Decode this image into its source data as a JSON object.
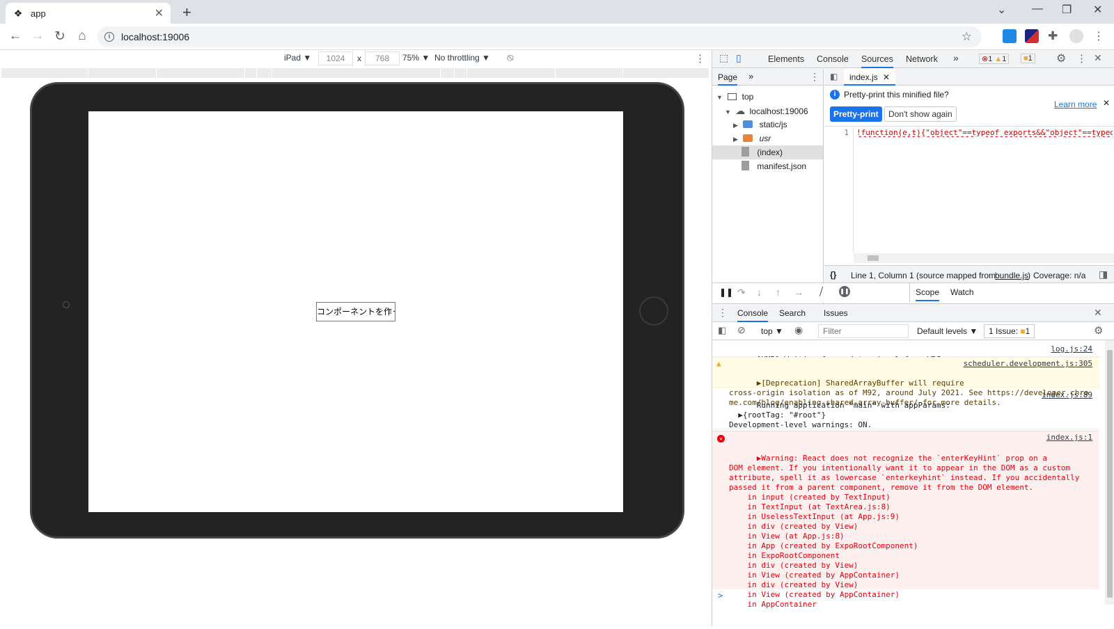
{
  "browser": {
    "tab_title": "app",
    "url": "localhost:19006"
  },
  "device_toolbar": {
    "device": "iPad ▼",
    "width": "1024",
    "x": "x",
    "height": "768",
    "zoom": "75% ▼",
    "throttling": "No throttling ▼"
  },
  "app": {
    "input_value": "コンポーネントを作って"
  },
  "devtools": {
    "tabs": [
      "Elements",
      "Console",
      "Sources",
      "Network"
    ],
    "more": "»",
    "badges": {
      "errors": "1",
      "warnings": "1",
      "issues": "1"
    },
    "navigator": {
      "header": "Page",
      "tree": [
        {
          "label": "top",
          "level": 0,
          "kind": "frame"
        },
        {
          "label": "localhost:19006",
          "level": 1,
          "kind": "cloud"
        },
        {
          "label": "static/js",
          "level": 2,
          "kind": "folder-blue"
        },
        {
          "label": "usr",
          "level": 2,
          "kind": "folder-orange"
        },
        {
          "label": "(index)",
          "level": 2,
          "kind": "file",
          "selected": true
        },
        {
          "label": "manifest.json",
          "level": 2,
          "kind": "file"
        }
      ]
    },
    "editor": {
      "tab": "index.js",
      "infobar_text": "Pretty-print this minified file?",
      "learn_more": "Learn more",
      "pretty_print": "Pretty-print",
      "dont_show": "Don't show again",
      "line_number": "1",
      "code": "!function(e,t){\"object\"==typeof exports&&\"object\"==typeof",
      "status_position": "Line 1, Column 1",
      "status_mapped_prefix": "(source mapped from ",
      "status_mapped_file": "bundle.js",
      "status_mapped_suffix": ")",
      "coverage": "Coverage: n/a",
      "format_icon": "{}"
    },
    "debugger": {
      "scope": "Scope",
      "watch": "Watch"
    },
    "drawer": {
      "tabs": [
        "Console",
        "Search",
        "Issues"
      ],
      "context": "top ▼",
      "filter_placeholder": "Filter",
      "levels": "Default levels ▼",
      "issues": "1 Issue:",
      "issues_count": "1",
      "prompt": ">"
    },
    "console_messages": {
      "hmr": {
        "text": "[HMR] Waiting for update signal from WDS...",
        "source": "log.js:24"
      },
      "deprecation": {
        "text": "▶[Deprecation] SharedArrayBuffer will require\ncross-origin isolation as of M92, around July 2021. See https://developer.chro\nme.com/blog/enabling-shared-array-buffer/ for more details.",
        "source": "scheduler.development.js:305"
      },
      "running": {
        "text": "Running application \"main\" with appParams:\n  ▶{rootTag: \"#root\"}\nDevelopment-level warnings: ON.\nPerformance optimizations: OFF.",
        "source": "index.js:89"
      },
      "react_warning": {
        "text": "▶Warning: React does not recognize the `enterKeyHint` prop on a\nDOM element. If you intentionally want it to appear in the DOM as a custom\nattribute, spell it as lowercase `enterkeyhint` instead. If you accidentally\npassed it from a parent component, remove it from the DOM element.\n    in input (created by TextInput)\n    in TextInput (at TextArea.js:8)\n    in UselessTextInput (at App.js:9)\n    in div (created by View)\n    in View (at App.js:8)\n    in App (created by ExpoRootComponent)\n    in ExpoRootComponent\n    in div (created by View)\n    in View (created by AppContainer)\n    in div (created by View)\n    in View (created by AppContainer)\n    in AppContainer",
        "source": "index.js:1"
      }
    }
  },
  "colors": {
    "accent": "#1a73e8",
    "error": "#e8000d",
    "warning_bg": "#fffbe5",
    "error_bg": "#fff0f0"
  }
}
